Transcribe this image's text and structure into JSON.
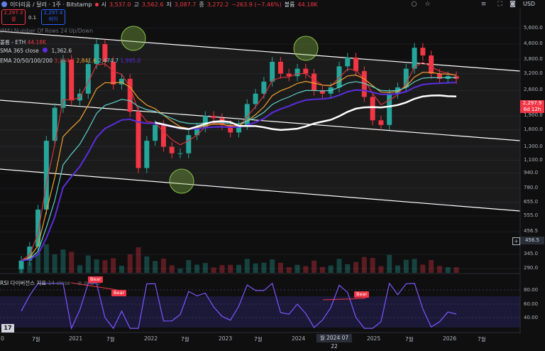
{
  "header": {
    "symbol": "이더리움 / 달러 · 1주 · Bitstamp",
    "open_label": "시",
    "open": "3,537.0",
    "high_label": "고",
    "high": "3,562.6",
    "low_label": "저",
    "low": "3,087.7",
    "close_label": "종",
    "close": "3,272.2",
    "change": "−263.9 (−7.46%)",
    "volume_label": "볼륨",
    "volume": "44.18K"
  },
  "trade": {
    "sell_price": "2,297.3",
    "sell_label": "셀",
    "spread": "0.1",
    "buy_price": "2,297.4",
    "buy_label": "바이"
  },
  "legends": {
    "ghost": "(MA) Number Of Rows 24 Up/Down",
    "volume_name": "볼륨 - ETH",
    "volume_value": "44.18K",
    "sma_name": "SMA 365 close",
    "sma_value": "1,362.6",
    "ema_name": "EMA 20/50/100/200",
    "ema_values": [
      "3,264.4",
      "2,841.6",
      "2,474.7",
      "1,995.0"
    ]
  },
  "rsi": {
    "name": "RSI 다이버전스 지표",
    "param": "14 close",
    "symbols": "⊘ ⊘ ⊘ ⊘",
    "labels": [
      "Bear",
      "Bear",
      "Bear"
    ],
    "ticks": [
      "80.00",
      "60.00",
      "40.00"
    ]
  },
  "price_axis": {
    "currency": "USD",
    "ticks": [
      "5,600.0",
      "4,600.0",
      "3,800.0",
      "3,200.0",
      "2,600.0",
      "1,900.0",
      "1,600.0",
      "1,300.0",
      "1,100.0",
      "940.0",
      "780.0",
      "655.0",
      "555.0",
      "456.5",
      "345.0",
      "290.0"
    ],
    "current_price": "2,297.9",
    "countdown": "6d 12h",
    "last_marker": "456.5"
  },
  "time_axis": {
    "labels": [
      "0",
      "7월",
      "2021",
      "7월",
      "2022",
      "7월",
      "2023",
      "7월",
      "2024",
      "2025",
      "7월",
      "2026",
      "7월"
    ],
    "cursor_label": "월 2024 07 22"
  },
  "colors": {
    "up": "#26a69a",
    "down": "#f23645",
    "ema20": "#d6333b",
    "ema50": "#f0a030",
    "ema100": "#5fd0c8",
    "ema200": "#5b2de0",
    "sma365": "#ffffff",
    "rsi": "#7e57ff",
    "channel": "#ffffff",
    "circle": "#8bc34a"
  },
  "icons": [
    "circle-icon",
    "star-icon",
    "list-icon",
    "fullscreen-icon",
    "camera-icon"
  ],
  "chart_data": {
    "type": "candlestick",
    "price_scale": "log",
    "ylim": [
      290,
      6200
    ],
    "x": [
      "2020-07",
      "2020-10",
      "2021-01",
      "2021-02",
      "2021-04",
      "2021-05",
      "2021-06",
      "2021-08",
      "2021-09",
      "2021-11",
      "2022-01",
      "2022-02",
      "2022-04",
      "2022-05",
      "2022-06",
      "2022-07",
      "2022-08",
      "2022-09",
      "2022-11",
      "2022-12",
      "2023-01",
      "2023-03",
      "2023-04",
      "2023-06",
      "2023-08",
      "2023-10",
      "2023-11",
      "2023-12",
      "2024-01",
      "2024-02",
      "2024-03",
      "2024-04",
      "2024-05",
      "2024-06",
      "2024-07",
      "2024-08",
      "2024-09",
      "2024-11",
      "2024-12",
      "2025-01",
      "2025-02",
      "2025-03",
      "2025-04",
      "2025-05",
      "2025-06",
      "2025-07",
      "2025-08",
      "2025-09",
      "2025-10",
      "2025-11",
      "2025-12",
      "2026-01",
      "2026-02"
    ],
    "series": [
      {
        "name": "ETH/USD weekly (approx. close)",
        "values": [
          320,
          380,
          600,
          1400,
          2100,
          3800,
          2300,
          2500,
          3600,
          4600,
          3700,
          2800,
          3000,
          2000,
          1000,
          1400,
          1700,
          1300,
          1200,
          1200,
          1500,
          1650,
          1900,
          1850,
          1700,
          1550,
          1700,
          2200,
          2500,
          2900,
          3700,
          3200,
          3100,
          3400,
          3200,
          2600,
          2500,
          2700,
          3500,
          3900,
          3300,
          2400,
          1800,
          1700,
          2500,
          2700,
          3400,
          4400,
          4000,
          3200,
          3000,
          3100,
          3000
        ]
      }
    ],
    "overlays": {
      "EMA 20": 3264.4,
      "EMA 50": 2841.6,
      "EMA 100": 2474.7,
      "EMA 200": 1995.0,
      "SMA 365": 1362.6
    },
    "rsi_ylim": [
      20,
      100
    ]
  }
}
